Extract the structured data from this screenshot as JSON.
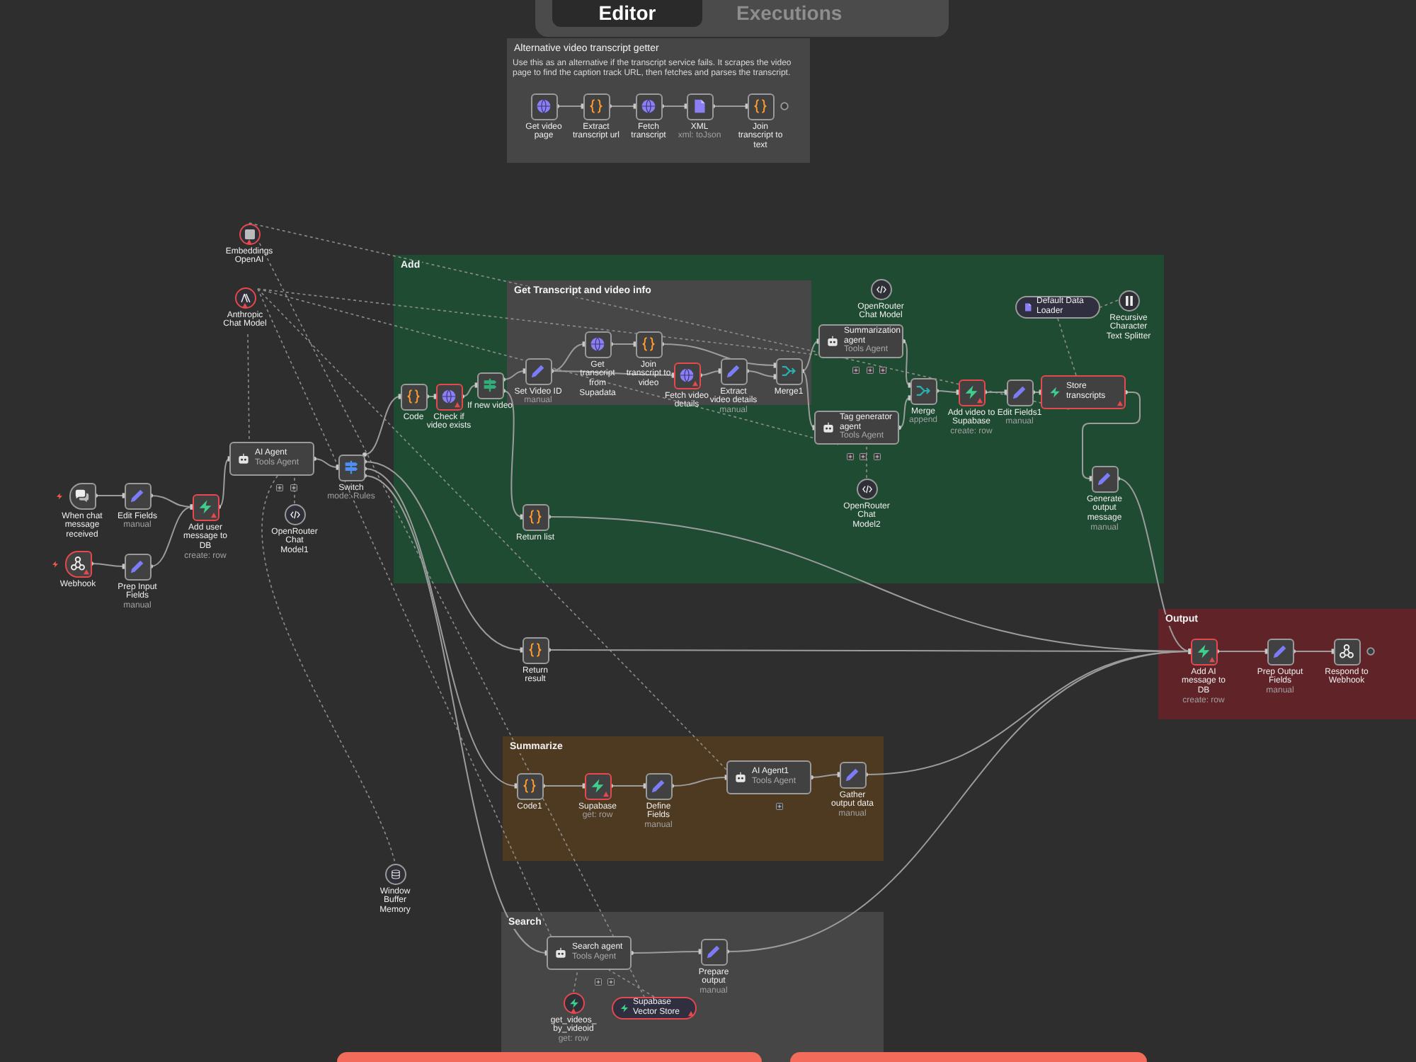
{
  "tabs": [
    {
      "label": "Editor",
      "selected": true
    },
    {
      "label": "Executions",
      "selected": false
    }
  ],
  "sticky_notes": [
    {
      "title": "Alternative video transcript getter",
      "text": "Use this as an alternative if the transcript service fails. It scrapes the video page to find the caption track URL, then fetches and parses the transcript.",
      "color": "#464646"
    },
    {
      "title": "Add",
      "color": "#1e4b32"
    },
    {
      "title": "Get Transcript and video info",
      "color": "#474747"
    },
    {
      "title": "Output",
      "color": "#5f2328"
    },
    {
      "title": "Summarize",
      "color": "#4e3a20"
    },
    {
      "title": "Search",
      "color": "#464646"
    }
  ],
  "nodes": [
    {
      "kind": "box",
      "label": "Get video page",
      "issue": false
    },
    {
      "kind": "box",
      "label": "Extract transcript url",
      "issue": false
    },
    {
      "kind": "box",
      "label": "Fetch transcript",
      "issue": false
    },
    {
      "kind": "box",
      "label": "XML",
      "subtitle": "xml: toJson",
      "issue": false
    },
    {
      "kind": "box",
      "label": "Join transcript to text",
      "issue": false
    },
    {
      "kind": "circle",
      "label": "Embeddings OpenAI",
      "issue": true
    },
    {
      "kind": "circle",
      "label": "Anthropic Chat Model",
      "issue": true
    },
    {
      "kind": "circle",
      "label": "OpenRouter Chat Model",
      "issue": false
    },
    {
      "kind": "pill",
      "label": "Default Data Loader",
      "issue": false
    },
    {
      "kind": "circle",
      "label": "Recursive Character Text Splitter",
      "issue": false
    },
    {
      "kind": "box",
      "label": "Code",
      "issue": false
    },
    {
      "kind": "box",
      "label": "Check if video exists",
      "issue": true
    },
    {
      "kind": "box",
      "label": "If new video",
      "issue": false
    },
    {
      "kind": "box",
      "label": "Set Video ID",
      "subtitle": "manual",
      "issue": false
    },
    {
      "kind": "box",
      "label": "Get transcript from Supadata",
      "issue": false
    },
    {
      "kind": "box",
      "label": "Join transcript to video",
      "issue": false
    },
    {
      "kind": "box",
      "label": "Fetch video details",
      "issue": true
    },
    {
      "kind": "box",
      "label": "Extract video details",
      "subtitle": "manual",
      "issue": false
    },
    {
      "kind": "box",
      "label": "Merge1",
      "issue": false
    },
    {
      "kind": "wide",
      "label": "Summarization agent",
      "subtitle": "Tools Agent",
      "issue": false
    },
    {
      "kind": "box",
      "label": "Merge",
      "subtitle": "append",
      "issue": false
    },
    {
      "kind": "box",
      "label": "Add video to Supabase",
      "subtitle": "create: row",
      "issue": true
    },
    {
      "kind": "box",
      "label": "Edit Fields1",
      "subtitle": "manual",
      "issue": false
    },
    {
      "kind": "wide",
      "label": "Store transcripts",
      "issue": true
    },
    {
      "kind": "wide",
      "label": "Tag generator agent",
      "subtitle": "Tools Agent",
      "issue": false
    },
    {
      "kind": "trigger",
      "label": "When chat message received",
      "issue": false
    },
    {
      "kind": "box",
      "label": "Edit Fields",
      "subtitle": "manual",
      "issue": false
    },
    {
      "kind": "box",
      "label": "Add user message to DB",
      "subtitle": "create: row",
      "issue": true
    },
    {
      "kind": "wide",
      "label": "AI Agent",
      "subtitle": "Tools Agent",
      "issue": false
    },
    {
      "kind": "circle",
      "label": "OpenRouter Chat Model1",
      "issue": false
    },
    {
      "kind": "box",
      "label": "Switch",
      "subtitle": "mode: Rules",
      "issue": false
    },
    {
      "kind": "box",
      "label": "Return list",
      "issue": false
    },
    {
      "kind": "circle",
      "label": "OpenRouter Chat Model2",
      "issue": false
    },
    {
      "kind": "box",
      "label": "Generate output message",
      "subtitle": "manual",
      "issue": false
    },
    {
      "kind": "trigger",
      "label": "Webhook",
      "issue": true
    },
    {
      "kind": "box",
      "label": "Prep Input Fields",
      "subtitle": "manual",
      "issue": false
    },
    {
      "kind": "box",
      "label": "Return result",
      "issue": false
    },
    {
      "kind": "box",
      "label": "Add AI message to DB",
      "subtitle": "create: row",
      "issue": true
    },
    {
      "kind": "box",
      "label": "Prep Output Fields",
      "subtitle": "manual",
      "issue": false
    },
    {
      "kind": "box",
      "label": "Respond to Webhook",
      "issue": false
    },
    {
      "kind": "box",
      "label": "Code1",
      "issue": false
    },
    {
      "kind": "box",
      "label": "Supabase",
      "subtitle": "get: row",
      "issue": true
    },
    {
      "kind": "box",
      "label": "Define Fields",
      "subtitle": "manual",
      "issue": false
    },
    {
      "kind": "wide",
      "label": "AI Agent1",
      "subtitle": "Tools Agent",
      "issue": false
    },
    {
      "kind": "box",
      "label": "Gather output data",
      "subtitle": "manual",
      "issue": false
    },
    {
      "kind": "circle",
      "label": "Window Buffer Memory",
      "issue": false
    },
    {
      "kind": "wide",
      "label": "Search agent",
      "subtitle": "Tools Agent",
      "issue": false
    },
    {
      "kind": "box",
      "label": "Prepare output",
      "subtitle": "manual",
      "issue": false
    },
    {
      "kind": "circle",
      "label": "get_videos_by_videoid",
      "subtitle": "get: row",
      "issue": true
    },
    {
      "kind": "pill",
      "label": "Supabase Vector Store",
      "issue": true
    }
  ]
}
